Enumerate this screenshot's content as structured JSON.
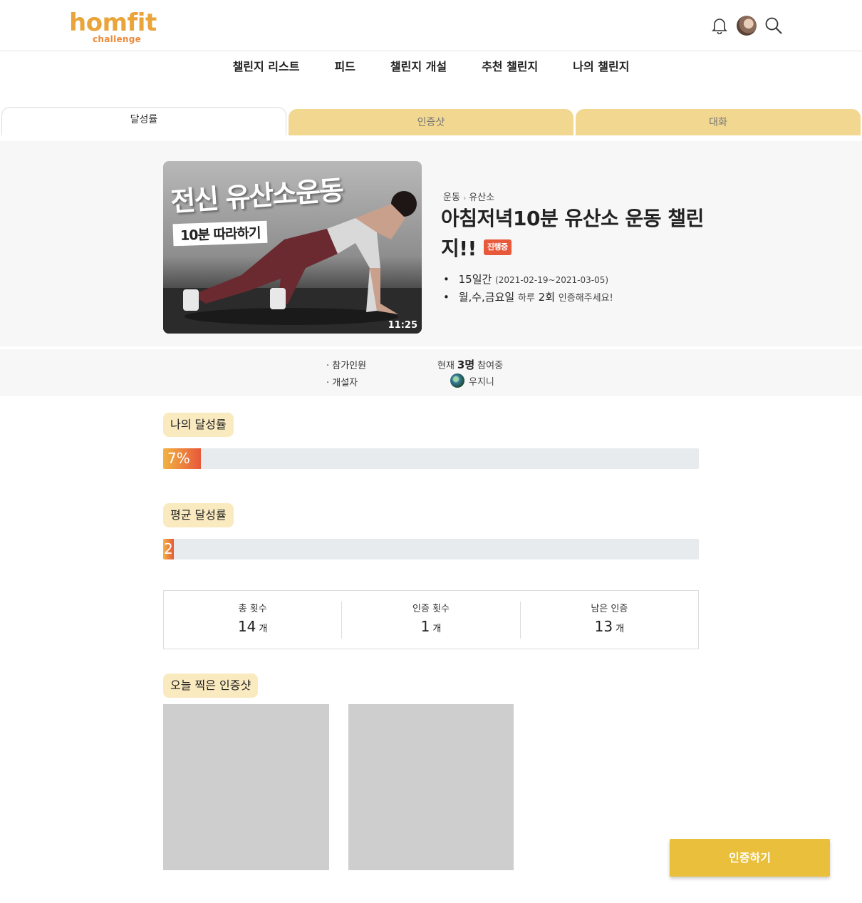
{
  "header": {
    "logo_main": "homfit",
    "logo_sub": "challenge",
    "icons": [
      "bell-icon",
      "avatar",
      "search-icon"
    ]
  },
  "nav": {
    "items": [
      "챌린지 리스트",
      "피드",
      "챌린지 개설",
      "추천 챌린지",
      "나의 챌린지"
    ]
  },
  "tabs": {
    "items": [
      "달성률",
      "인증샷",
      "대화"
    ],
    "active": "달성률"
  },
  "challenge": {
    "thumbnail": {
      "title": "전신 유산소운동",
      "subtitle": "10분 따라하기",
      "duration": "11:25"
    },
    "category": "운동",
    "subcategory": "유산소",
    "title": "아침저녁10분 유산소 운동 챌린지!!",
    "status": "진행중",
    "period_days": "15일간",
    "period_range": "(2021-02-19~2021-03-05)",
    "days": "월,수,금요일",
    "per_day_prefix": "하루",
    "per_day_count": "2회",
    "per_day_suffix": "인증해주세요!"
  },
  "participants": {
    "count_label": "참가인원",
    "creator_label": "개설자",
    "count_prefix": "현재",
    "count_value": "3명",
    "count_suffix": "참여중",
    "creator_name": "우지니"
  },
  "progress": {
    "mine_label": "나의 달성률",
    "mine_value": 7,
    "mine_text": "7%",
    "avg_label": "평균 달성률",
    "avg_value": 2,
    "avg_text": "2"
  },
  "stats": [
    {
      "label": "총 횟수",
      "value": "14",
      "unit": "개"
    },
    {
      "label": "인증 횟수",
      "value": "1",
      "unit": "개"
    },
    {
      "label": "남은 인증",
      "value": "13",
      "unit": "개"
    }
  ],
  "today": {
    "label": "오늘 찍은 인증샷"
  },
  "cta": {
    "label": "인증하기"
  },
  "colors": {
    "accent": "#e9bf3b",
    "tab_inactive": "#f1d78f",
    "label_bg": "#faeac0",
    "status_badge": "#e8583a"
  }
}
